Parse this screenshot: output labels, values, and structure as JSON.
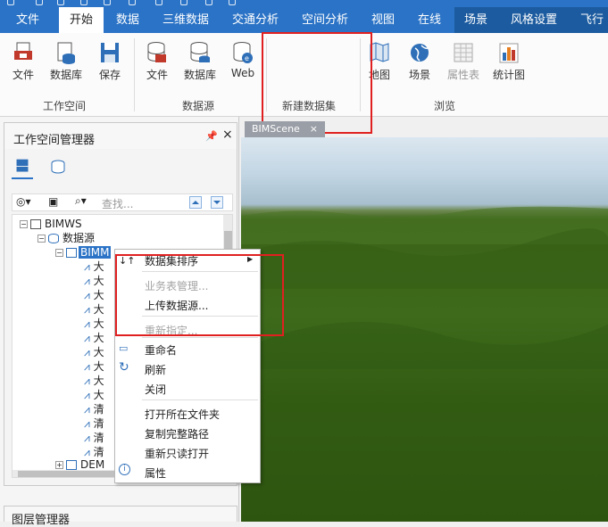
{
  "menu": {
    "tabs": [
      "文件",
      "开始",
      "数据",
      "三维数据",
      "交通分析",
      "空间分析",
      "视图",
      "在线",
      "场景",
      "风格设置",
      "飞行"
    ],
    "active": "开始"
  },
  "ribbon": {
    "workspace": {
      "items": [
        "文件",
        "数据库",
        "保存"
      ],
      "label": "工作空间"
    },
    "datasource": {
      "items": [
        "文件",
        "数据库",
        "Web"
      ],
      "label": "数据源"
    },
    "newdataset": {
      "label": "新建数据集"
    },
    "browse": {
      "items": [
        "地图",
        "场景",
        "属性表",
        "统计图"
      ],
      "label": "浏览"
    }
  },
  "panel": {
    "title": "工作空间管理器",
    "search_placeholder": "查找...",
    "tree": {
      "root": "BIMWS",
      "datasources": "数据源",
      "bim": "BIMM",
      "child_da": "大",
      "child_qing": "清",
      "dem": "DEM"
    },
    "bottom_title": "图层管理器"
  },
  "scene": {
    "tab": "BIMScene"
  },
  "context_menu": {
    "sort": "数据集排序",
    "business": "业务表管理...",
    "upload": "上传数据源...",
    "reassign": "重新指定...",
    "rename": "重命名",
    "refresh": "刷新",
    "close": "关闭",
    "open_folder": "打开所在文件夹",
    "copy_path": "复制完整路径",
    "reopen_readonly": "重新只读打开",
    "properties": "属性"
  },
  "colors": {
    "accent": "#2b73c6",
    "highlight": "#e02020"
  }
}
